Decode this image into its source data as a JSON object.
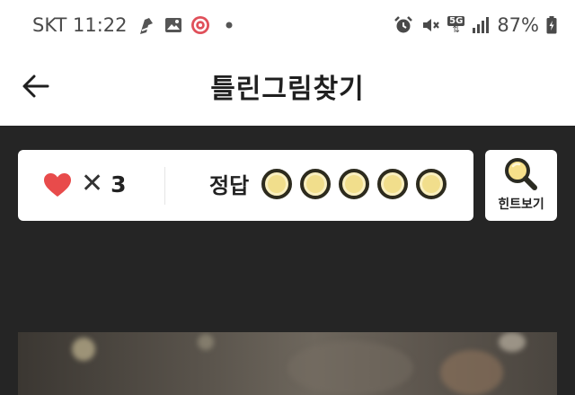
{
  "status_bar": {
    "carrier_time": "SKT 11:22",
    "network": "5G",
    "battery": "87%",
    "icons_left": [
      "accessibility-icon",
      "gallery-icon",
      "app-notification-icon",
      "dot-icon"
    ],
    "icons_right": [
      "alarm-icon",
      "mute-icon",
      "network-5g-icon",
      "signal-icon",
      "battery-icon"
    ]
  },
  "header": {
    "title": "틀린그림찾기"
  },
  "score_card": {
    "lives_times": "✕",
    "lives_count": "3",
    "answers_label": "정답",
    "answers_total": 5,
    "answers_found": 0
  },
  "hint": {
    "label": "힌트보기"
  },
  "colors": {
    "background_dark": "#252525",
    "heart": "#e84b4b",
    "answer_circle": "#f1de8c",
    "hint_icon": "#f2c94c"
  }
}
